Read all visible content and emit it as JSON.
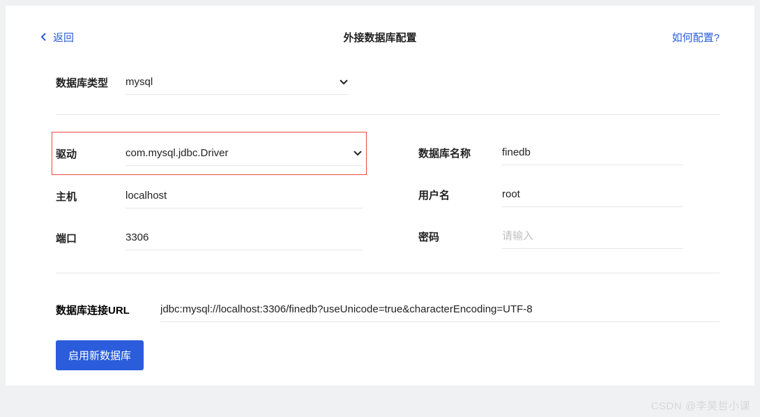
{
  "header": {
    "back_label": "返回",
    "title": "外接数据库配置",
    "help_label": "如何配置?"
  },
  "db_type": {
    "label": "数据库类型",
    "value": "mysql"
  },
  "left_fields": {
    "driver": {
      "label": "驱动",
      "value": "com.mysql.jdbc.Driver"
    },
    "host": {
      "label": "主机",
      "value": "localhost"
    },
    "port": {
      "label": "端口",
      "value": "3306"
    }
  },
  "right_fields": {
    "db_name": {
      "label": "数据库名称",
      "value": "finedb"
    },
    "username": {
      "label": "用户名",
      "value": "root"
    },
    "password": {
      "label": "密码",
      "placeholder": "请输入",
      "value": ""
    }
  },
  "url": {
    "label": "数据库连接URL",
    "value": "jdbc:mysql://localhost:3306/finedb?useUnicode=true&characterEncoding=UTF-8"
  },
  "submit_label": "启用新数据库",
  "watermark": "CSDN @李昊哲小课"
}
